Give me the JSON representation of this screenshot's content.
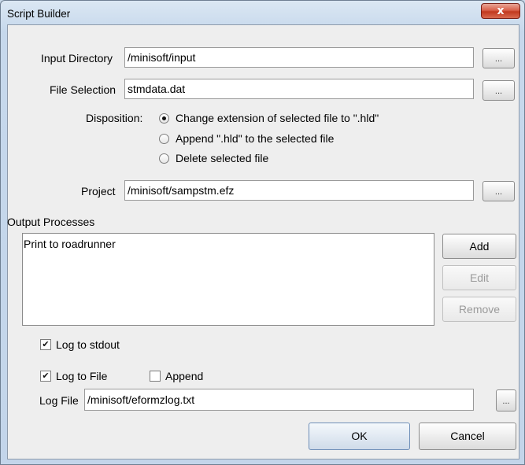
{
  "window": {
    "title": "Script Builder",
    "close_glyph": "x"
  },
  "form": {
    "input_directory_label": "Input Directory",
    "input_directory_value": "/minisoft/input",
    "file_selection_label": "File Selection",
    "file_selection_value": "stmdata.dat",
    "browse_label": "...",
    "disposition_label": "Disposition:",
    "disposition_options": [
      "Change extension of selected file to \".hld\"",
      "Append \".hld\" to the selected file",
      "Delete selected file"
    ],
    "disposition_selected": 0,
    "project_label": "Project",
    "project_value": "/minisoft/sampstm.efz"
  },
  "output_processes": {
    "heading": "Output Processes",
    "items": [
      "Print to roadrunner"
    ],
    "add_label": "Add",
    "edit_label": "Edit",
    "remove_label": "Remove"
  },
  "logging": {
    "log_stdout_label": "Log to stdout",
    "log_stdout_checked": true,
    "log_file_label": "Log to File",
    "log_file_checked": true,
    "append_label": "Append",
    "append_checked": false,
    "log_file_field_label": "Log File",
    "log_file_value": "/minisoft/eformzlog.txt",
    "check_glyph": "✔"
  },
  "actions": {
    "ok_label": "OK",
    "cancel_label": "Cancel"
  }
}
